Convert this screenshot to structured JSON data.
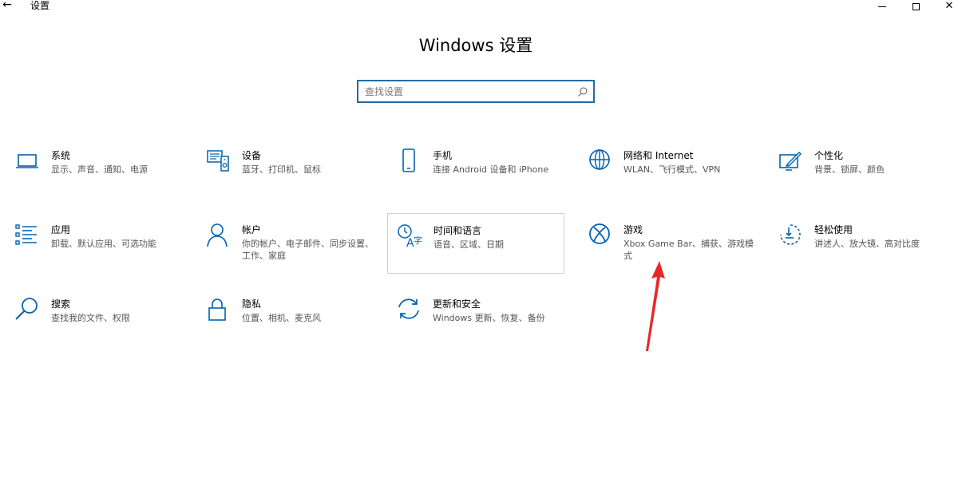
{
  "window": {
    "title": "设置",
    "back_icon": "back-arrow-icon",
    "close_glyph": "✕"
  },
  "page": {
    "title": "Windows 设置"
  },
  "search": {
    "placeholder": "查找设置",
    "value": ""
  },
  "tiles": [
    {
      "id": "system",
      "title": "系统",
      "desc": "显示、声音、通知、电源",
      "icon": "laptop-icon"
    },
    {
      "id": "devices",
      "title": "设备",
      "desc": "蓝牙、打印机、鼠标",
      "icon": "devices-icon"
    },
    {
      "id": "phone",
      "title": "手机",
      "desc": "连接 Android 设备和 iPhone",
      "icon": "phone-icon"
    },
    {
      "id": "network",
      "title": "网络和 Internet",
      "desc": "WLAN、飞行模式、VPN",
      "icon": "globe-icon"
    },
    {
      "id": "personalization",
      "title": "个性化",
      "desc": "背景、锁屏、颜色",
      "icon": "paint-icon"
    },
    {
      "id": "apps",
      "title": "应用",
      "desc": "卸载、默认应用、可选功能",
      "icon": "apps-list-icon"
    },
    {
      "id": "accounts",
      "title": "帐户",
      "desc": "你的帐户、电子邮件、同步设置、工作、家庭",
      "icon": "person-icon"
    },
    {
      "id": "time-language",
      "title": "时间和语言",
      "desc": "语音、区域、日期",
      "icon": "time-language-icon"
    },
    {
      "id": "gaming",
      "title": "游戏",
      "desc": "Xbox Game Bar、捕获、游戏模式",
      "icon": "xbox-icon"
    },
    {
      "id": "ease-of-access",
      "title": "轻松使用",
      "desc": "讲述人、放大镜、高对比度",
      "icon": "ease-of-access-icon"
    },
    {
      "id": "search",
      "title": "搜索",
      "desc": "查找我的文件、权限",
      "icon": "magnifier-icon"
    },
    {
      "id": "privacy",
      "title": "隐私",
      "desc": "位置、相机、麦克风",
      "icon": "lock-icon"
    },
    {
      "id": "update-security",
      "title": "更新和安全",
      "desc": "Windows 更新、恢复、备份",
      "icon": "sync-icon"
    }
  ],
  "colors": {
    "accent": "#0063b1",
    "search_border": "#1d6ea8",
    "annotation_arrow": "#e8272a"
  }
}
